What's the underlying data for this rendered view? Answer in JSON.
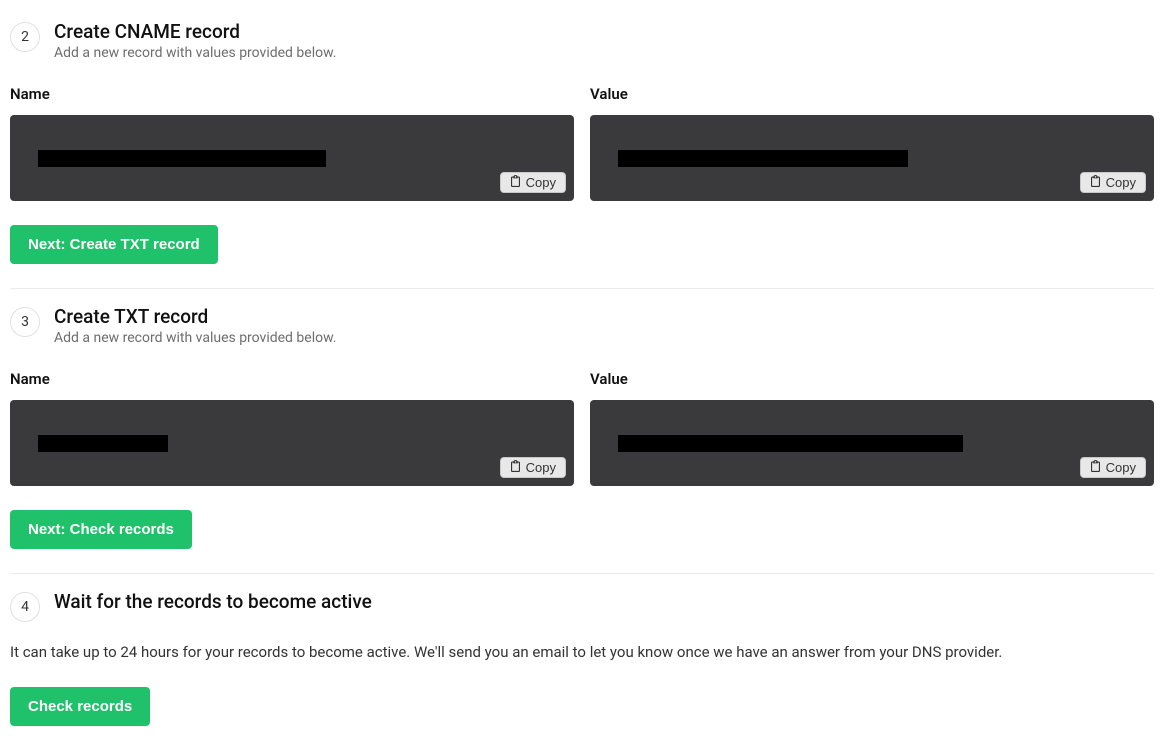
{
  "steps": {
    "s2": {
      "number": "2",
      "title": "Create CNAME record",
      "subtitle": "Add a new record with values provided below.",
      "name_label": "Name",
      "value_label": "Value",
      "name_redact_width": 288,
      "value_redact_width": 290,
      "copy_label": "Copy",
      "next_button": "Next: Create TXT record"
    },
    "s3": {
      "number": "3",
      "title": "Create TXT record",
      "subtitle": "Add a new record with values provided below.",
      "name_label": "Name",
      "value_label": "Value",
      "name_redact_width": 130,
      "value_redact_width": 345,
      "copy_label": "Copy",
      "next_button": "Next: Check records"
    },
    "s4": {
      "number": "4",
      "title": "Wait for the records to become active",
      "body": "It can take up to 24 hours for your records to become active. We'll send you an email to let you know once we have an answer from your DNS provider.",
      "button": "Check records"
    }
  }
}
